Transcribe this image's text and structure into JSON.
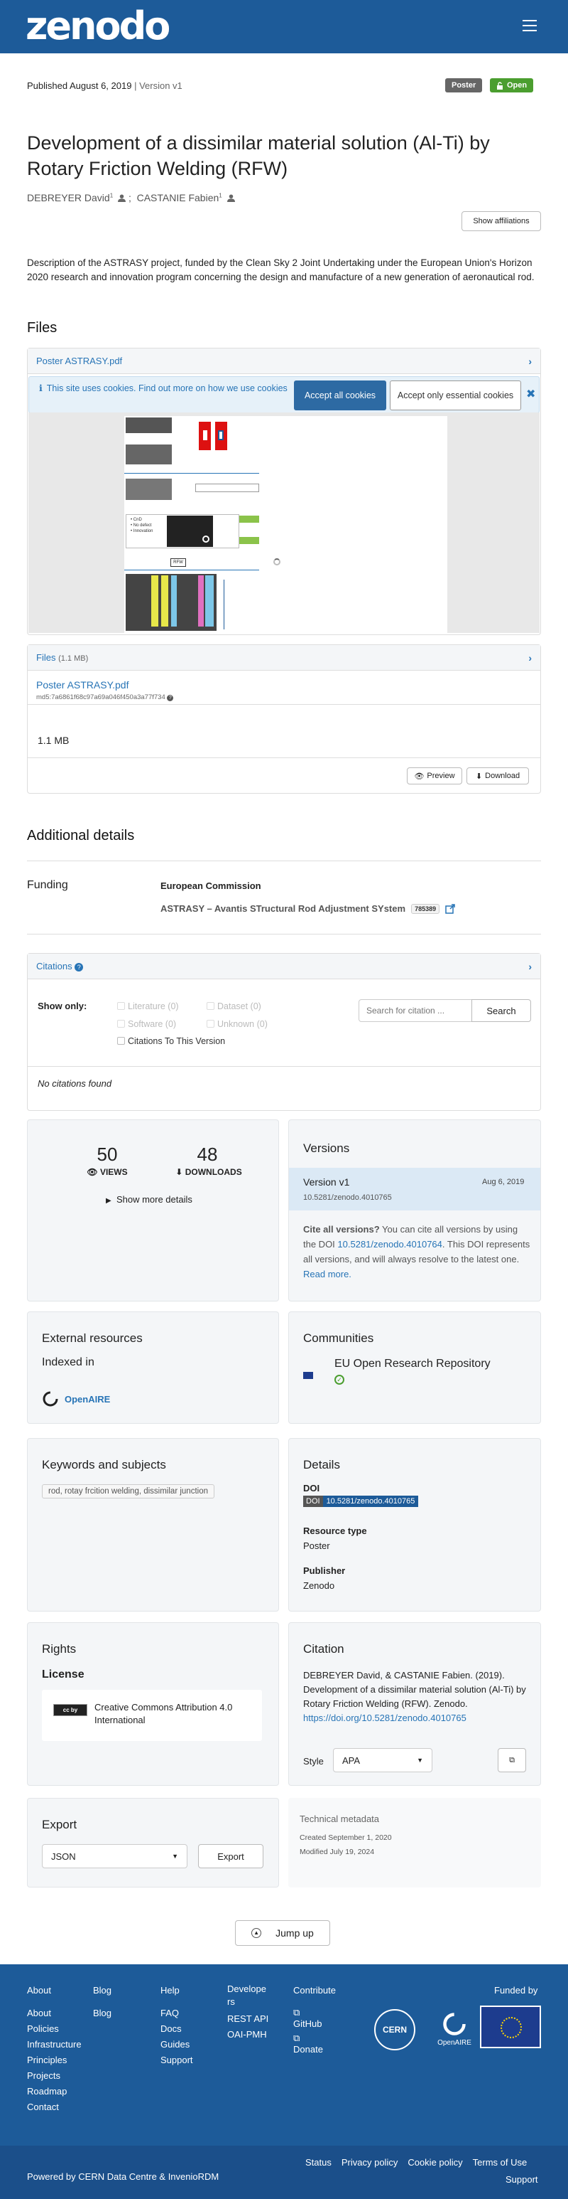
{
  "header": {
    "logo": "zenodo"
  },
  "record": {
    "published": "Published August 6, 2019",
    "version": "Version v1",
    "badge_type": "Poster",
    "badge_access": "Open",
    "title": "Development of a dissimilar material solution (Al-Ti) by Rotary Friction Welding (RFW)",
    "authors": [
      {
        "name": "DEBREYER David",
        "sup": "1"
      },
      {
        "name": "CASTANIE Fabien",
        "sup": "1"
      }
    ],
    "author_sep": ";",
    "show_affiliations": "Show affiliations",
    "description": "Description of the ASTRASY project, funded by the Clean Sky 2 Joint Undertaking under the European Union's Horizon 2020 research and innovation program concerning the design and manufacture of a new generation of aeronautical rod."
  },
  "files": {
    "heading": "Files",
    "preview_file": "Poster ASTRASY.pdf",
    "cookie_text": "This site uses cookies. Find out more on how we use cookies",
    "accept_all": "Accept all cookies",
    "accept_essential": "Accept only essential cookies",
    "files_label": "Files",
    "files_size": "(1.1 MB)",
    "file_name": "Poster ASTRASY.pdf",
    "md5": "md5:7a6861f68c97a69a046f450a3a77f734",
    "file_size": "1.1 MB",
    "preview_btn": "Preview",
    "download_btn": "Download",
    "poster_box_label": "RFW",
    "poster_bullets": [
      "CnD",
      "No defect",
      "Innovation"
    ]
  },
  "details": {
    "heading": "Additional details",
    "funding_label": "Funding",
    "funder": "European Commission",
    "grant": "ASTRASY – Avantis STructural Rod Adjustment SYstem",
    "grant_id": "785389"
  },
  "citations": {
    "header": "Citations",
    "show_only": "Show only:",
    "filters": [
      "Literature (0)",
      "Dataset (0)",
      "Software (0)",
      "Unknown (0)"
    ],
    "to_version": "Citations To This Version",
    "search_placeholder": "Search for citation ...",
    "search_btn": "Search",
    "empty": "No citations found"
  },
  "stats": {
    "views": "50",
    "views_label": "VIEWS",
    "downloads": "48",
    "downloads_label": "DOWNLOADS",
    "more": "Show more details"
  },
  "versions": {
    "title": "Versions",
    "current": "Version v1",
    "date": "Aug 6, 2019",
    "doi": "10.5281/zenodo.4010765",
    "cite_bold": "Cite all versions?",
    "cite_text1": " You can cite all versions by using the DOI ",
    "cite_doi": "10.5281/zenodo.4010764",
    "cite_text2": ". This DOI represents all versions, and will always resolve to the latest one. ",
    "read_more": "Read more."
  },
  "external": {
    "title": "External resources",
    "indexed": "Indexed in",
    "openaire": "OpenAIRE"
  },
  "communities": {
    "title": "Communities",
    "name": "EU Open Research Repository"
  },
  "keywords": {
    "title": "Keywords and subjects",
    "tag": "rod, rotay frcition welding, dissimilar junction"
  },
  "meta": {
    "title": "Details",
    "doi_label": "DOI",
    "doi_tag": "DOI",
    "doi": "10.5281/zenodo.4010765",
    "rtype_label": "Resource type",
    "rtype": "Poster",
    "publisher_label": "Publisher",
    "publisher": "Zenodo"
  },
  "rights": {
    "title": "Rights",
    "license_label": "License",
    "cc_badge": "cc by",
    "license": "Creative Commons Attribution 4.0 International"
  },
  "citation": {
    "title": "Citation",
    "text": "DEBREYER David, & CASTANIE Fabien. (2019). Development of a dissimilar material solution (Al-Ti) by Rotary Friction Welding (RFW). Zenodo.",
    "link": "https://doi.org/10.5281/zenodo.4010765",
    "style_label": "Style",
    "style": "APA"
  },
  "export": {
    "title": "Export",
    "format": "JSON",
    "btn": "Export"
  },
  "technical": {
    "title": "Technical metadata",
    "created": "Created September 1, 2020",
    "modified": "Modified July 19, 2024"
  },
  "jump": "Jump up",
  "footer": {
    "about_h": "About",
    "about": [
      "About",
      "Policies",
      "Infrastructure",
      "Principles",
      "Projects",
      "Roadmap",
      "Contact"
    ],
    "blog_h": "Blog",
    "blog": [
      "Blog"
    ],
    "help_h": "Help",
    "help": [
      "FAQ",
      "Docs",
      "Guides",
      "Support"
    ],
    "dev_h1": "Develope",
    "dev_h2": "rs",
    "dev": [
      "REST API",
      "OAI-PMH"
    ],
    "contrib_h": "Contribute",
    "github": "GitHub",
    "donate": "Donate",
    "funded": "Funded by",
    "cern": "CERN",
    "openaire": "OpenAIRE",
    "powered": "Powered by CERN Data Centre & InvenioRDM",
    "links": [
      "Status",
      "Privacy policy",
      "Cookie policy",
      "Terms of Use"
    ],
    "support": "Support"
  },
  "colors": {
    "brand": "#1d5b99",
    "poster_badge": "#666666",
    "open_badge": "#4b9e2f",
    "footer_dark": "#1b4f8a",
    "link": "#2774b6"
  }
}
